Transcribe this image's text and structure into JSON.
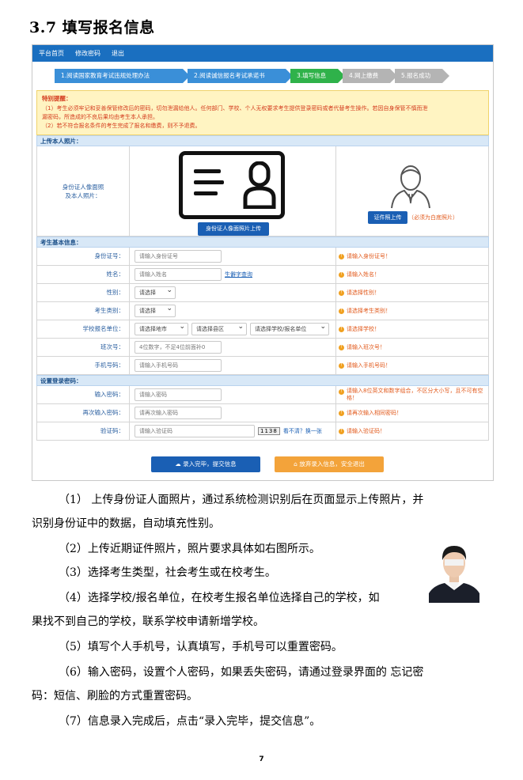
{
  "heading": "3.7  填写报名信息",
  "topnav": [
    "平台首页",
    "修改密码",
    "退出"
  ],
  "steps": [
    {
      "label": "1.阅读国家教育考试违规处理办法",
      "state": "blue"
    },
    {
      "label": "2.阅读诚信报名考试承诺书",
      "state": "blue"
    },
    {
      "label": "3.填写信息",
      "state": "green"
    },
    {
      "label": "4.网上缴费",
      "state": "gray"
    },
    {
      "label": "5.报名成功",
      "state": "gray"
    }
  ],
  "notice": {
    "title": "特别提醒：",
    "lines": [
      "（1）考生必须牢记和妥善保管修改后的密码，切勿泄漏给他人。任何部门、学校、个人无权要求考生提供登录密码或者代替考生操作。若因自身保管不慎而泄",
      "漏密码，所造成的不良后果均由考生本人承担。",
      "（2）若不符合报名条件的考生完成了报名和缴费，则不予退费。"
    ]
  },
  "photo_section": {
    "title": "上传本人照片：",
    "label_line1": "身份证人像面照",
    "label_line2": "及本人照片：",
    "upload_id_button": "身份证人像面照片上传",
    "upload_photo_button": "证件照上传",
    "photo_note": "（必须为白底照片）"
  },
  "basic_section": {
    "title": "考生基本信息：",
    "rows": [
      {
        "label": "身份证号：",
        "placeholder": "请输入身份证号",
        "hint": "请输入身份证号！"
      },
      {
        "label": "姓名：",
        "placeholder": "请输入姓名",
        "link": "生僻字查询",
        "hint": "请输入姓名！"
      },
      {
        "label": "性别：",
        "select": "请选择",
        "hint": "请选择性别！"
      },
      {
        "label": "考生类别：",
        "select": "请选择",
        "hint": "请选择考生类别！"
      },
      {
        "label": "学校报名单位：",
        "selects": [
          "请选择地市",
          "请选择县区",
          "请选择学校/报名单位"
        ],
        "hint": "请选择学校！"
      },
      {
        "label": "班次号：",
        "placeholder": "4位数字，不足4位前面补0",
        "hint": "请输入班次号！"
      },
      {
        "label": "手机号码：",
        "placeholder": "请输入手机号码",
        "hint": "请输入手机号码！"
      }
    ]
  },
  "login_section": {
    "title": "设置登录密码：",
    "rows": [
      {
        "label": "输入密码：",
        "placeholder": "请输入密码",
        "hint": "请输入8位英文和数字组合，不区分大小写，且不可有空格！"
      },
      {
        "label": "再次输入密码：",
        "placeholder": "请再次输入密码",
        "hint": "请再次输入相同密码！"
      },
      {
        "label": "验证码：",
        "placeholder": "请输入验证码",
        "captcha": "1138",
        "captcha_link": "看不清？换一张",
        "hint": "请输入验证码！"
      }
    ]
  },
  "actions": {
    "submit": "☁ 录入完毕，提交信息",
    "exit": "⌂ 放弃录入信息，安全退出"
  },
  "paragraphs": [
    "（1）  上传身份证人面照片，通过系统检测识别后在页面显示上传照片，并",
    "识别身份证中的数据，自动填充性别。",
    "（2）上传近期证件照片，照片要求具体如右图所示。",
    "（3）选择考生类型，社会考生或在校考生。",
    "（4）选择学校/报名单位，在校考生报名单位选择自己的学校，如",
    "果找不到自己的学校，联系学校申请新增学校。",
    "（5）填写个人手机号，认真填写，手机号可以重置密码。",
    "（6）输入密码，设置个人密码，如果丢失密码，请通过登录界面的 忘记密",
    "码：短信、刷脸的方式重置密码。",
    "（7）信息录入完成后，点击“录入完毕，提交信息”。"
  ],
  "page_number": "7"
}
